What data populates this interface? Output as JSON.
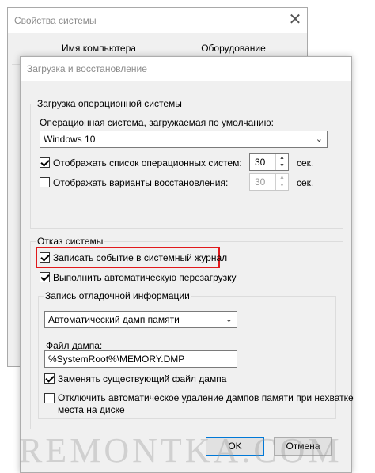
{
  "background_window": {
    "title": "Свойства системы",
    "tabs": [
      "Имя компьютера",
      "Оборудование"
    ]
  },
  "dialog": {
    "title": "Загрузка и восстановление",
    "startup": {
      "group_label": "Загрузка операционной системы",
      "default_os_label": "Операционная система, загружаемая по умолчанию:",
      "default_os_value": "Windows 10",
      "show_os_list_label": "Отображать список операционных систем:",
      "show_os_list_checked": true,
      "show_os_list_seconds": "30",
      "show_recovery_label": "Отображать варианты восстановления:",
      "show_recovery_checked": false,
      "show_recovery_seconds": "30",
      "seconds_unit": "сек."
    },
    "failure": {
      "group_label": "Отказ системы",
      "write_event_label": "Записать событие в системный журнал",
      "write_event_checked": true,
      "auto_restart_label": "Выполнить автоматическую перезагрузку",
      "auto_restart_checked": true,
      "debug": {
        "group_label": "Запись отладочной информации",
        "dump_type_value": "Автоматический дамп памяти",
        "dump_file_label": "Файл дампа:",
        "dump_file_value": "%SystemRoot%\\MEMORY.DMP",
        "overwrite_label": "Заменять существующий файл дампа",
        "overwrite_checked": true,
        "disable_auto_delete_label_line1": "Отключить автоматическое удаление дампов памяти при нехватке",
        "disable_auto_delete_label_line2": "места на диске",
        "disable_auto_delete_checked": false
      }
    },
    "buttons": {
      "ok": "OK",
      "cancel": "Отмена"
    }
  },
  "watermark": "REMONTKA.COM",
  "colors": {
    "highlight": "#e0191b",
    "accent": "#0078d7"
  }
}
